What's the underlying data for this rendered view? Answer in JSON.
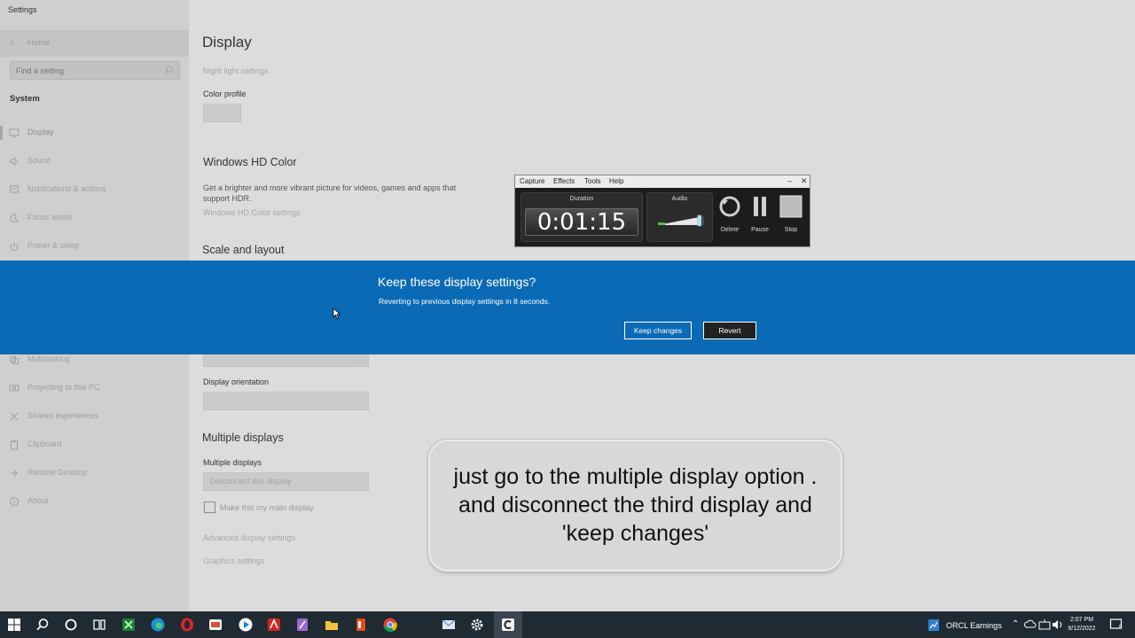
{
  "window": {
    "title": "Settings"
  },
  "sidebar": {
    "home_label": "Home",
    "search_placeholder": "Find a setting",
    "section": "System",
    "items": [
      {
        "label": "Display",
        "icon": "monitor-icon"
      },
      {
        "label": "Sound",
        "icon": "speaker-icon"
      },
      {
        "label": "Notifications & actions",
        "icon": "notification-icon"
      },
      {
        "label": "Focus assist",
        "icon": "moon-icon"
      },
      {
        "label": "Power & sleep",
        "icon": "power-icon"
      },
      {
        "label": "Multitasking",
        "icon": "multitasking-icon"
      },
      {
        "label": "Projecting to this PC",
        "icon": "projector-icon"
      },
      {
        "label": "Shared experiences",
        "icon": "shared-icon"
      },
      {
        "label": "Clipboard",
        "icon": "clipboard-icon"
      },
      {
        "label": "Remote Desktop",
        "icon": "remote-desktop-icon"
      },
      {
        "label": "About",
        "icon": "info-icon"
      }
    ]
  },
  "content": {
    "title": "Display",
    "night_light_link": "Night light settings",
    "color_profile_label": "Color profile",
    "hd_color_heading": "Windows HD Color",
    "hd_color_desc": "Get a brighter and more vibrant picture for videos, games and apps that support HDR.",
    "hd_color_link": "Windows HD Color settings",
    "scale_heading": "Scale and layout",
    "orientation_label": "Display orientation",
    "multiple_heading": "Multiple displays",
    "multiple_label": "Multiple displays",
    "multiple_value": "Disconnect this display",
    "main_display_checkbox": "Make this my main display",
    "advanced_link": "Advanced display settings",
    "graphics_link": "Graphics settings"
  },
  "dialog": {
    "title": "Keep these display settings?",
    "message": "Reverting to previous display settings in  8 seconds.",
    "keep_label": "Keep changes",
    "revert_label": "Revert"
  },
  "recorder": {
    "menu": [
      "Capture",
      "Effects",
      "Tools",
      "Help"
    ],
    "duration_caption": "Duration",
    "duration_value": "0:01:15",
    "audio_caption": "Audio",
    "audio_level": 0.9,
    "delete_label": "Delete",
    "pause_label": "Pause",
    "stop_label": "Stop"
  },
  "caption": {
    "text": "just go to the multiple display option . and disconnect the third display and 'keep changes'"
  },
  "taskbar": {
    "apps": [
      "windows-start-icon",
      "search-icon",
      "cortana-icon",
      "task-view-icon",
      "excel-icon",
      "edge-icon",
      "opera-icon",
      "app-icon",
      "blue-app-icon",
      "acrobat-icon",
      "notes-icon",
      "file-explorer-icon",
      "office-icon",
      "chrome-icon",
      "mail-icon",
      "settings-icon",
      "camtasia-icon"
    ],
    "ticker": "ORCL  Earnings",
    "time": "2:07 PM",
    "date": "9/12/2022",
    "notification_count": "6"
  },
  "colors": {
    "dialog_bg": "#0a6ab5",
    "revert_bg": "#222222",
    "taskbar_bg": "#1f2a33"
  }
}
